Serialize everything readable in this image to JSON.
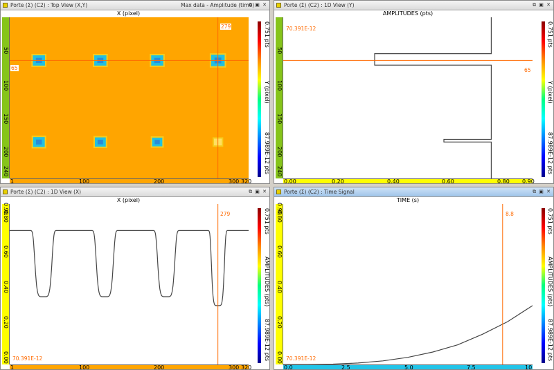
{
  "colors": {
    "plot_bg": "#ffa500",
    "accent": "#ff6a00",
    "curve": "#444444",
    "time_axis": "#22c4e8",
    "yellow_axis": "#ffff00",
    "green_axis": "#86c41a"
  },
  "panel_top_view": {
    "title": "Porte (Σ) (C2) : Top View (X,Y)",
    "title_right": "Max data - Amplitude (time)",
    "controls": "⧉ ▣ ✕",
    "axis_title": "X (pixel)",
    "vertical_label": "Y (pixel)",
    "colorbar_max": "0.751 pts",
    "colorbar_min": "87.989E-12 pts",
    "cursor_x": "279",
    "cursor_y": "65",
    "x_ticks": [
      "1",
      "100",
      "200",
      "300",
      "320"
    ],
    "y_ticks": [
      "50",
      "100",
      "150",
      "200",
      "240"
    ],
    "chart_data": {
      "type": "heatmap",
      "xlabel": "X (pixel)",
      "ylabel": "Y (pixel)",
      "xlim": [
        1,
        320
      ],
      "ylim": [
        1,
        240
      ],
      "background_level": 0.751,
      "spots": [
        {
          "x": 40,
          "y": 65,
          "level": 0.42
        },
        {
          "x": 122,
          "y": 65,
          "level": 0.42
        },
        {
          "x": 198,
          "y": 65,
          "level": 0.42
        },
        {
          "x": 279,
          "y": 65,
          "level": 0.33
        },
        {
          "x": 40,
          "y": 186,
          "level": 0.45
        },
        {
          "x": 122,
          "y": 186,
          "level": 0.5
        },
        {
          "x": 198,
          "y": 186,
          "level": 0.55
        },
        {
          "x": 279,
          "y": 186,
          "level": 0.7
        }
      ]
    }
  },
  "panel_view_y": {
    "title": "Porte (Σ) (C2) : 1D View (Y)",
    "controls": "⧉ ▣ ✕",
    "axis_title": "AMPLITUDES (pts)",
    "vertical_label": "Y (pixel)",
    "colorbar_max": "0.751 pts",
    "colorbar_min": "87.989E-12 pts",
    "corner_value": "70.391E-12",
    "cursor_y": "65",
    "x_ticks": [
      "0.00",
      "0.20",
      "0.40",
      "0.60",
      "0.80",
      "0.90"
    ],
    "y_ticks": [
      "50",
      "100",
      "150",
      "200",
      "240"
    ],
    "chart_data": {
      "type": "line",
      "xlabel": "AMPLITUDES (pts)",
      "ylabel": "Y (pixel)",
      "xlim": [
        0,
        0.9
      ],
      "ylim": [
        1,
        240
      ],
      "cursor_y": 65,
      "points": [
        [
          0.751,
          1
        ],
        [
          0.751,
          55
        ],
        [
          0.33,
          55
        ],
        [
          0.33,
          72
        ],
        [
          0.751,
          72
        ],
        [
          0.751,
          182
        ],
        [
          0.58,
          182
        ],
        [
          0.58,
          186
        ],
        [
          0.751,
          186
        ],
        [
          0.751,
          240
        ]
      ]
    }
  },
  "panel_view_x": {
    "title": "Porte (Σ) (C2) : 1D View (X)",
    "controls": "⧉ ▣ ✕",
    "axis_title": "X (pixel)",
    "vertical_label": "AMPLITUDES (pts)",
    "colorbar_max": "0.751 pts",
    "colorbar_min": "87.989E-12 pts",
    "corner_value": "70.391E-12",
    "cursor_x": "279",
    "x_ticks": [
      "1",
      "100",
      "200",
      "300",
      "320"
    ],
    "y_ticks": [
      "0.00",
      "0.20",
      "0.40",
      "0.60",
      "0.80",
      "0.90"
    ],
    "chart_data": {
      "type": "line",
      "xlabel": "X (pixel)",
      "ylabel": "AMPLITUDES (pts)",
      "xlim": [
        1,
        320
      ],
      "ylim": [
        0,
        0.9
      ],
      "cursor_x": 279,
      "baseline": 0.751,
      "dips": [
        {
          "center": 46,
          "min": 0.38,
          "half_width": 12
        },
        {
          "center": 128,
          "min": 0.38,
          "half_width": 12
        },
        {
          "center": 210,
          "min": 0.38,
          "half_width": 12
        },
        {
          "center": 279,
          "min": 0.33,
          "half_width": 9
        }
      ]
    }
  },
  "panel_time": {
    "title": "Porte (Σ) (C2) : Time Signal",
    "controls": "⧉ ▣ ✕",
    "axis_title": "TIME (s)",
    "vertical_label": "AMPLITUDES (pts)",
    "colorbar_max": "0.751 pts",
    "colorbar_min": "87.989E-12 pts",
    "corner_value": "70.391E-12",
    "cursor_label": "8.8",
    "x_ticks": [
      "0.0",
      "2.5",
      "5.0",
      "7.5",
      "10"
    ],
    "y_ticks": [
      "0.00",
      "0.20",
      "0.40",
      "0.60",
      "0.80",
      "0.90"
    ],
    "chart_data": {
      "type": "line",
      "xlabel": "TIME (s)",
      "ylabel": "AMPLITUDES (pts)",
      "xlim": [
        0,
        10
      ],
      "ylim": [
        0,
        0.9
      ],
      "cursor_x": 8.8,
      "x": [
        0,
        1,
        2,
        3,
        4,
        5,
        6,
        7,
        8,
        9,
        10
      ],
      "values": [
        0.0,
        0.0,
        0.002,
        0.008,
        0.02,
        0.04,
        0.07,
        0.11,
        0.17,
        0.24,
        0.33
      ]
    }
  }
}
